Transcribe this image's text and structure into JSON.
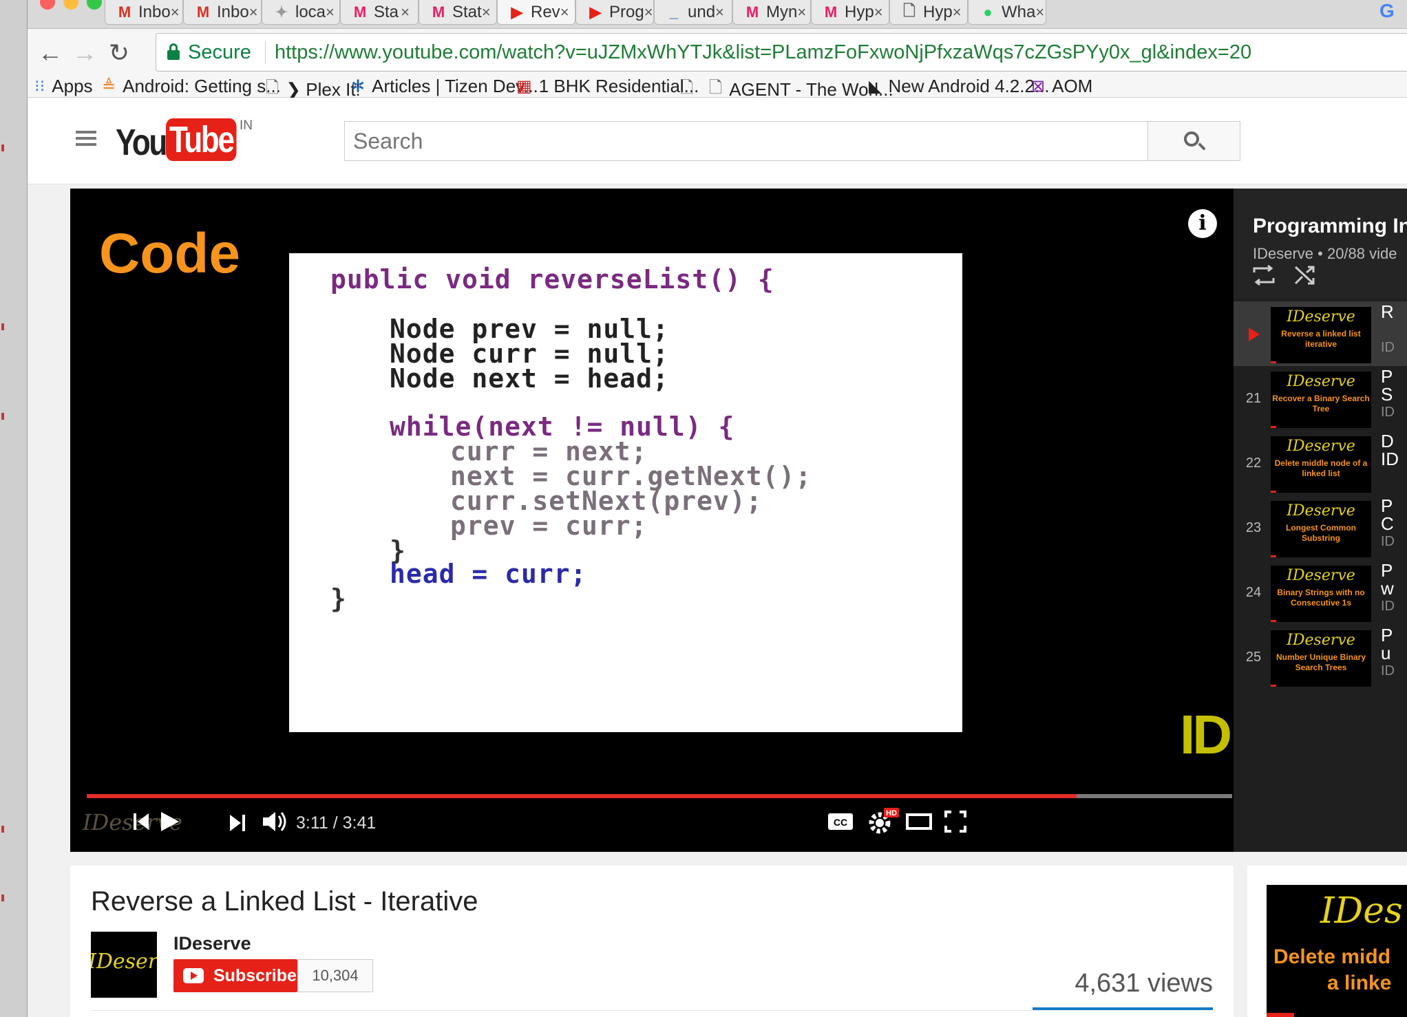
{
  "browser": {
    "tabs": [
      {
        "label": "Inbo",
        "icon": "gmail-icon",
        "glyph": "M",
        "color": "#d93025"
      },
      {
        "label": "Inbo",
        "icon": "gmail-icon",
        "glyph": "M",
        "color": "#d93025"
      },
      {
        "label": "loca",
        "icon": "puzzle-icon",
        "glyph": "✦",
        "color": "#999999"
      },
      {
        "label": "Sta",
        "icon": "myntra-icon",
        "glyph": "M",
        "color": "#e91e63"
      },
      {
        "label": "Stat",
        "icon": "myntra-icon",
        "glyph": "M",
        "color": "#e91e63"
      },
      {
        "label": "Rev",
        "icon": "youtube-icon",
        "glyph": "▶",
        "color": "#e62117",
        "active": true
      },
      {
        "label": "Prog",
        "icon": "youtube-icon",
        "glyph": "▶",
        "color": "#e62117"
      },
      {
        "label": "und",
        "icon": "underline-icon",
        "glyph": "_",
        "color": "#1a5fb4"
      },
      {
        "label": "Myn",
        "icon": "myntra-icon",
        "glyph": "M",
        "color": "#e91e63"
      },
      {
        "label": "Hyp",
        "icon": "myntra-icon",
        "glyph": "M",
        "color": "#e91e63"
      },
      {
        "label": "Hyp",
        "icon": "page-icon",
        "glyph": "🗋",
        "color": "#666666"
      },
      {
        "label": "Wha",
        "icon": "whatsapp-icon",
        "glyph": "●",
        "color": "#25d366"
      }
    ],
    "security_label": "Secure",
    "url": "https://www.youtube.com/watch?v=uJZMxWhYTJk&list=PLamzFoFxwoNjPfxzaWqs7cZGsPYy0x_gl&index=20",
    "bookmarks": [
      {
        "label": "Apps",
        "icon": "apps-grid-icon"
      },
      {
        "label": "Android: Getting s...",
        "icon": "stackoverflow-icon"
      },
      {
        "label": "❯ Plex It!",
        "icon": "page-icon"
      },
      {
        "label": "Articles | Tizen Dev...",
        "icon": "tizen-icon"
      },
      {
        "label": "1 BHK Residential...",
        "icon": "magicbricks-icon"
      },
      {
        "label": "",
        "icon": "page-icon"
      },
      {
        "label": "AGENT - The Worl...",
        "icon": "page-icon"
      },
      {
        "label": "New Android 4.2.2...",
        "icon": "bird-icon"
      },
      {
        "label": "AOM",
        "icon": "aom-icon"
      }
    ]
  },
  "youtube": {
    "region": "IN",
    "search_placeholder": "Search",
    "player": {
      "slide_heading": "Code",
      "code_lines": [
        "public void reverseList() {",
        "Node prev = null;",
        "Node curr = null;",
        "Node next = head;",
        "while(next != null) {",
        "curr = next;",
        "next = curr.getNext();",
        "curr.setNext(prev);",
        "prev = curr;",
        "}",
        "head = curr;",
        "}"
      ],
      "brand_mark": "ID",
      "watermark": "IDeserve",
      "time_display": "3:11 / 3:41",
      "progress_fraction": 0.864,
      "hd_badge": "HD"
    },
    "playlist": {
      "title": "Programming In",
      "meta": "IDeserve • 20/88 vide",
      "items": [
        {
          "number": "",
          "thumb_title": "Reverse a linked list iterative",
          "cut": [
            "R",
            "",
            "ID"
          ],
          "current": true
        },
        {
          "number": "21",
          "thumb_title": "Recover a Binary Search Tree",
          "cut": [
            "P",
            "S",
            "ID"
          ]
        },
        {
          "number": "22",
          "thumb_title": "Delete middle node of a linked list",
          "cut": [
            "D",
            "ID",
            ""
          ]
        },
        {
          "number": "23",
          "thumb_title": "Longest Common Substring",
          "cut": [
            "P",
            "C",
            "ID"
          ]
        },
        {
          "number": "24",
          "thumb_title": "Binary Strings with no Consecutive 1s",
          "cut": [
            "P",
            "w",
            "ID"
          ]
        },
        {
          "number": "25",
          "thumb_title": "Number Unique Binary Search Trees",
          "cut": [
            "P",
            "u",
            "ID"
          ]
        }
      ],
      "thumb_brand": "IDeserve"
    },
    "video": {
      "title": "Reverse a Linked List - Iterative",
      "channel": "IDeserve",
      "subscribe_label": "Subscribe",
      "subscriber_count": "10,304",
      "views": "4,631 views"
    },
    "next_up": {
      "brand": "IDes",
      "line1": "Delete midd",
      "line2": "a linke"
    }
  }
}
